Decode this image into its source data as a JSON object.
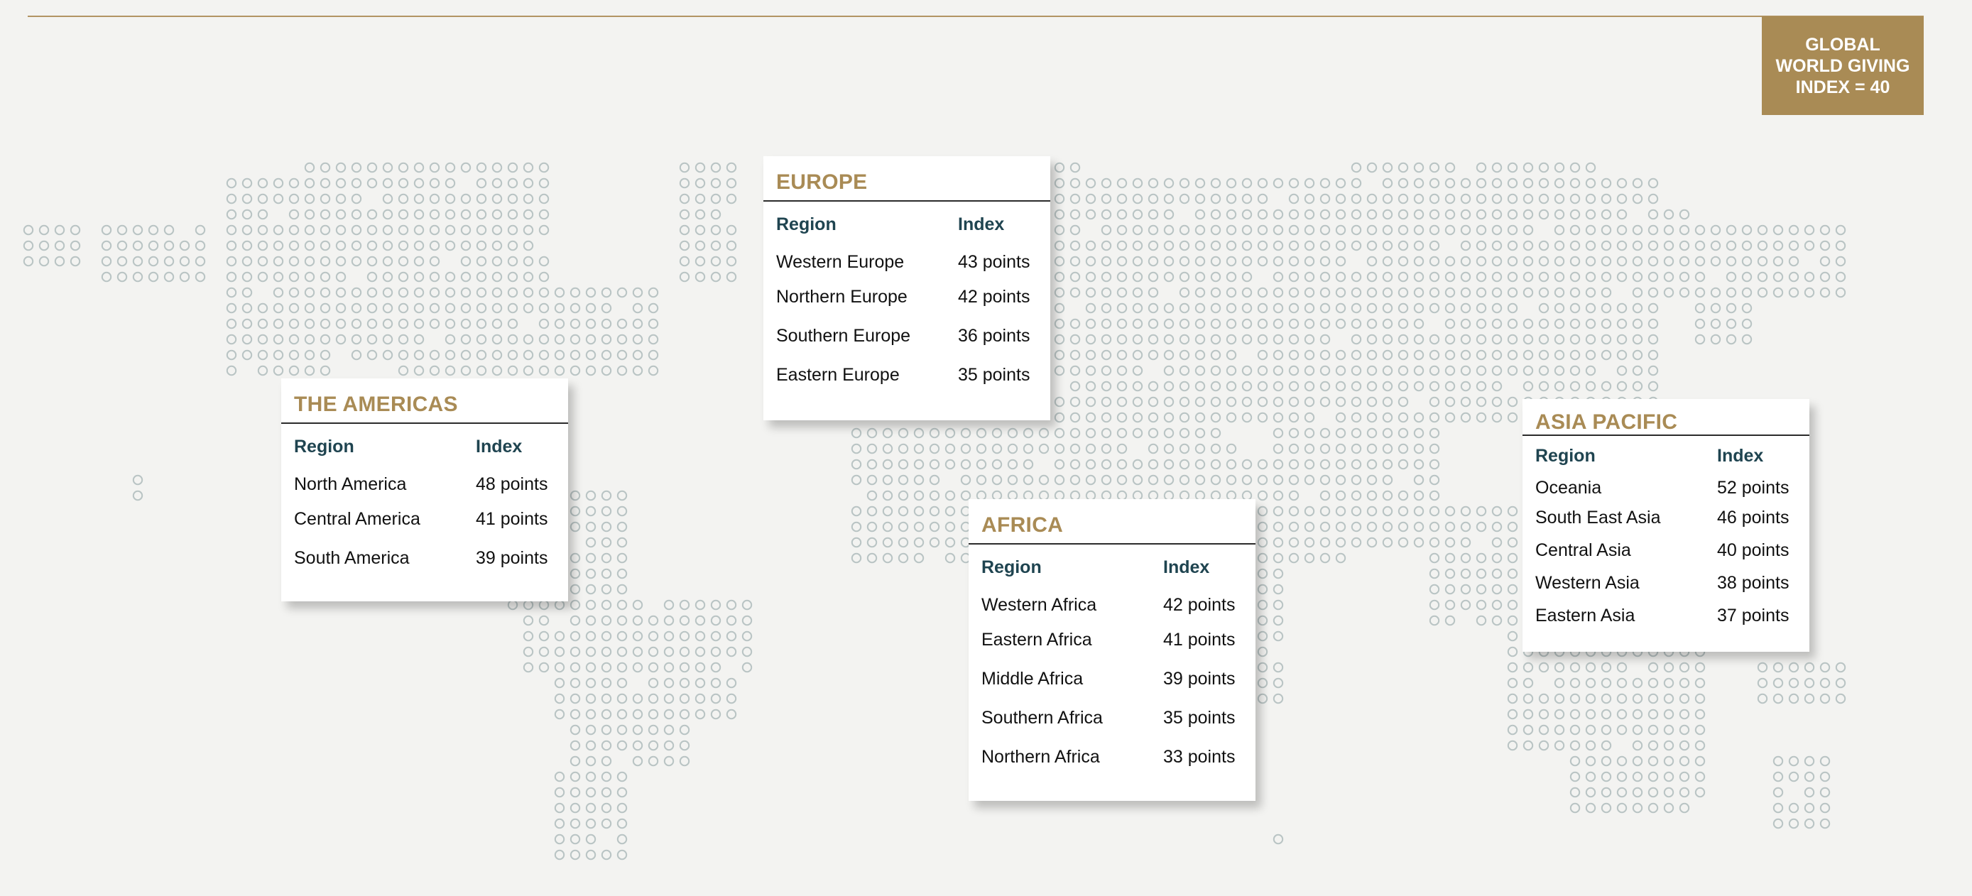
{
  "header": {
    "badge_lines": [
      "GLOBAL",
      "WORLD GIVING",
      "INDEX = 40"
    ]
  },
  "colors": {
    "accent_gold": "#a98b55",
    "header_teal": "#1f4450",
    "map_dot": "#b9c4c4",
    "background": "#f3f3f1"
  },
  "regions": {
    "americas": {
      "title": "THE AMERICAS",
      "col_region": "Region",
      "col_index": "Index",
      "rows": [
        {
          "region": "North America",
          "index": "48 points"
        },
        {
          "region": "Central America",
          "index": "41 points"
        },
        {
          "region": "South America",
          "index": "39 points"
        }
      ]
    },
    "europe": {
      "title": "EUROPE",
      "col_region": "Region",
      "col_index": "Index",
      "rows": [
        {
          "region": "Western Europe",
          "index": "43 points"
        },
        {
          "region": "Northern Europe",
          "index": "42 points"
        },
        {
          "region": "Southern Europe",
          "index": "36 points"
        },
        {
          "region": "Eastern Europe",
          "index": "35 points"
        }
      ]
    },
    "africa": {
      "title": "AFRICA",
      "col_region": "Region",
      "col_index": "Index",
      "rows": [
        {
          "region": "Western Africa",
          "index": "42 points"
        },
        {
          "region": "Eastern Africa",
          "index": "41 points"
        },
        {
          "region": "Middle Africa",
          "index": "39 points"
        },
        {
          "region": "Southern Africa",
          "index": "35 points"
        },
        {
          "region": "Northern Africa",
          "index": "33 points"
        }
      ]
    },
    "asia_pacific": {
      "title": "ASIA PACIFIC",
      "col_region": "Region",
      "col_index": "Index",
      "rows": [
        {
          "region": "Oceania",
          "index": "52 points"
        },
        {
          "region": "South East Asia",
          "index": "46 points"
        },
        {
          "region": "Central Asia",
          "index": "40 points"
        },
        {
          "region": "Western Asia",
          "index": "38 points"
        },
        {
          "region": "Eastern Asia",
          "index": "37 points"
        }
      ]
    }
  }
}
